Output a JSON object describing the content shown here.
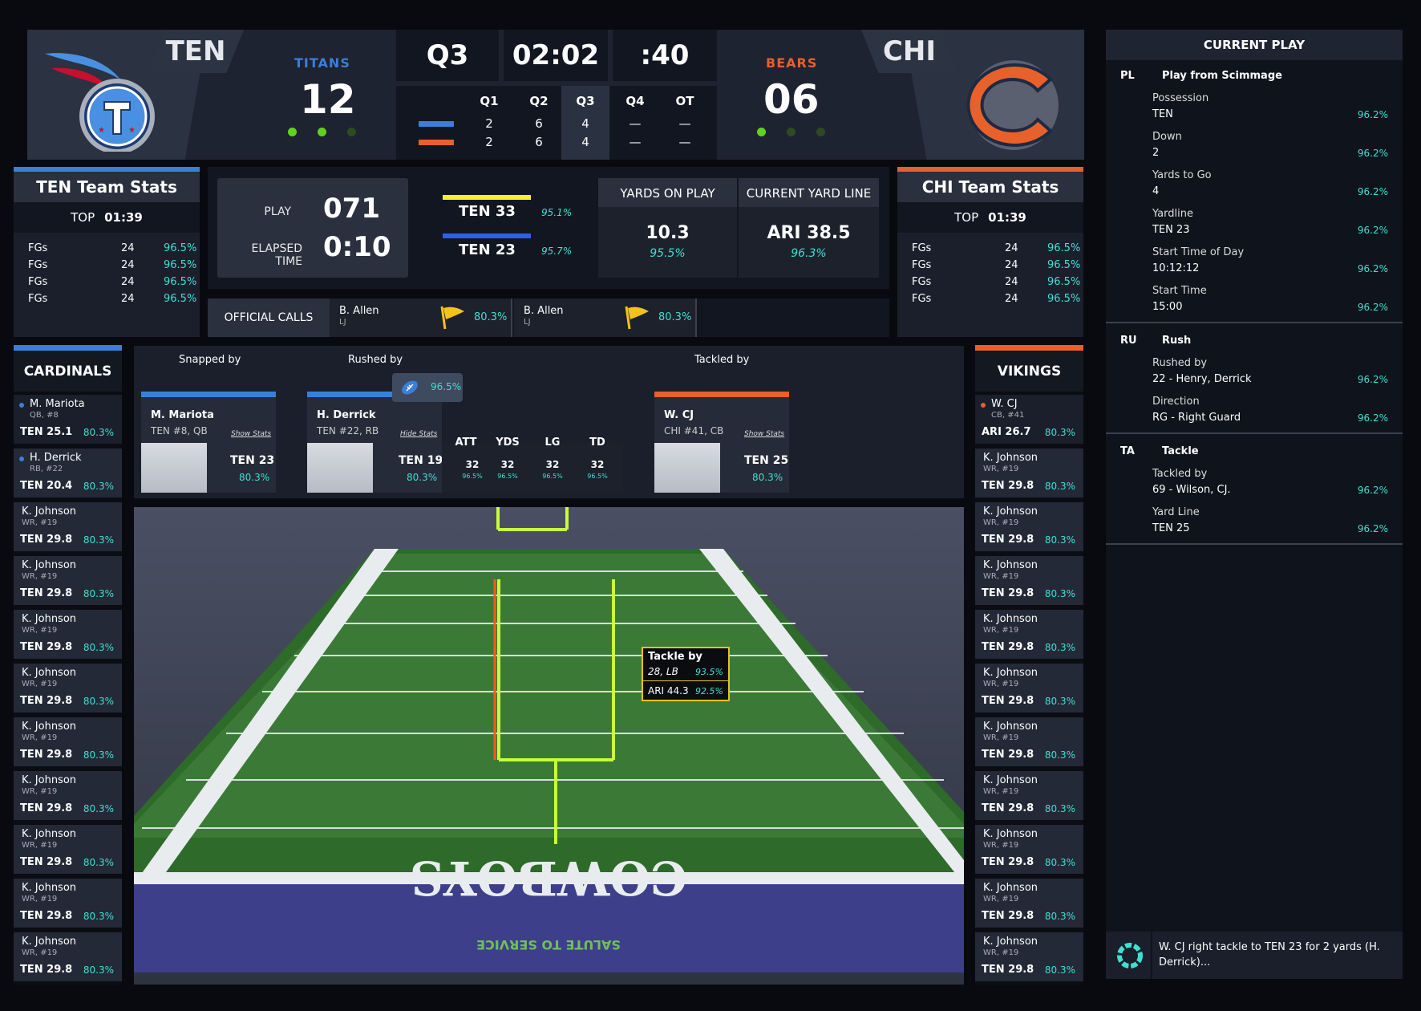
{
  "scoreboard": {
    "home": {
      "code": "TEN",
      "name": "TITANS",
      "score": "12",
      "color": "#3b7fd8"
    },
    "away": {
      "code": "CHI",
      "name": "BEARS",
      "score": "06",
      "color": "#e8602a"
    },
    "quarter": "Q3",
    "clock": "02:02",
    "play_clock": ":40",
    "periods": [
      "Q1",
      "Q2",
      "Q3",
      "Q4",
      "OT"
    ],
    "home_periods": [
      "2",
      "6",
      "4",
      "—",
      "—"
    ],
    "away_periods": [
      "2",
      "6",
      "4",
      "—",
      "—"
    ]
  },
  "ten_stats": {
    "title": "TEN Team Stats",
    "top_label": "TOP",
    "top_value": "01:39",
    "rows": [
      {
        "label": "FGs",
        "value": "24",
        "pct": "96.5%"
      },
      {
        "label": "FGs",
        "value": "24",
        "pct": "96.5%"
      },
      {
        "label": "FGs",
        "value": "24",
        "pct": "96.5%"
      },
      {
        "label": "FGs",
        "value": "24",
        "pct": "96.5%"
      }
    ]
  },
  "chi_stats": {
    "title": "CHI Team Stats",
    "top_label": "TOP",
    "top_value": "01:39",
    "rows": [
      {
        "label": "FGs",
        "value": "24",
        "pct": "96.5%"
      },
      {
        "label": "FGs",
        "value": "24",
        "pct": "96.5%"
      },
      {
        "label": "FGs",
        "value": "24",
        "pct": "96.5%"
      },
      {
        "label": "FGs",
        "value": "24",
        "pct": "96.5%"
      }
    ]
  },
  "play_info": {
    "play_label": "PLAY",
    "play_value": "071",
    "elapsed_label_1": "ELAPSED",
    "elapsed_label_2": "TIME",
    "elapsed_value": "0:10",
    "line1": {
      "label": "TEN 33",
      "pct": "95.1%",
      "color": "#f5f22a"
    },
    "line2": {
      "label": "TEN 23",
      "pct": "95.7%",
      "color": "#2f5fe8"
    },
    "yards_on_play_label": "YARDS ON PLAY",
    "yards_on_play_value": "10.3",
    "yards_on_play_pct": "95.5%",
    "yard_line_label": "CURRENT YARD LINE",
    "yard_line_value": "ARI 38.5",
    "yard_line_pct": "96.3%"
  },
  "official_calls": {
    "label": "OFFICIAL CALLS",
    "calls": [
      {
        "name": "B. Allen",
        "pos": "LJ",
        "pct": "80.3%"
      },
      {
        "name": "B. Allen",
        "pos": "LJ",
        "pct": "80.3%"
      }
    ]
  },
  "play_cards": {
    "snapped_label": "Snapped by",
    "rushed_label": "Rushed by",
    "tackled_label": "Tackled by",
    "ball_pct": "96.5%",
    "snapper": {
      "name": "M. Mariota",
      "sub": "TEN #8, QB",
      "link": "Show Stats",
      "yardline": "TEN 23",
      "pct": "80.3%"
    },
    "rusher": {
      "name": "H. Derrick",
      "sub": "TEN #22, RB",
      "link": "Hide Stats",
      "yardline": "TEN 19",
      "pct": "80.3%",
      "stats": [
        {
          "label": "ATT",
          "value": "32",
          "pct": "96.5%"
        },
        {
          "label": "YDS",
          "value": "32",
          "pct": "96.5%"
        },
        {
          "label": "LG",
          "value": "32",
          "pct": "96.5%"
        },
        {
          "label": "TD",
          "value": "32",
          "pct": "96.5%"
        }
      ]
    },
    "tackler": {
      "name": "W. CJ",
      "sub": "CHI #41, CB",
      "link": "Show Stats",
      "yardline": "TEN 25",
      "pct": "80.3%"
    }
  },
  "field": {
    "tackle_label": "Tackle by",
    "tackle_player": "28, LB",
    "tackle_pct": "93.5%",
    "tackle_yardline": "ARI 44.3",
    "tackle_yardline_pct": "92.5%",
    "end_zone_text": "COWBOYS",
    "banner_text": "SALUTE TO SERVICE"
  },
  "cardinals": {
    "title": "CARDINALS",
    "players": [
      {
        "name": "M. Mariota",
        "sub": "QB, #8",
        "yardline": "TEN 25.1",
        "pct": "80.3%"
      },
      {
        "name": "H. Derrick",
        "sub": "RB, #22",
        "yardline": "TEN 20.4",
        "pct": "80.3%"
      },
      {
        "name": "K. Johnson",
        "sub": "WR, #19",
        "yardline": "TEN 29.8",
        "pct": "80.3%"
      },
      {
        "name": "K. Johnson",
        "sub": "WR, #19",
        "yardline": "TEN 29.8",
        "pct": "80.3%"
      },
      {
        "name": "K. Johnson",
        "sub": "WR, #19",
        "yardline": "TEN 29.8",
        "pct": "80.3%"
      },
      {
        "name": "K. Johnson",
        "sub": "WR, #19",
        "yardline": "TEN 29.8",
        "pct": "80.3%"
      },
      {
        "name": "K. Johnson",
        "sub": "WR, #19",
        "yardline": "TEN 29.8",
        "pct": "80.3%"
      },
      {
        "name": "K. Johnson",
        "sub": "WR, #19",
        "yardline": "TEN 29.8",
        "pct": "80.3%"
      },
      {
        "name": "K. Johnson",
        "sub": "WR, #19",
        "yardline": "TEN 29.8",
        "pct": "80.3%"
      },
      {
        "name": "K. Johnson",
        "sub": "WR, #19",
        "yardline": "TEN 29.8",
        "pct": "80.3%"
      },
      {
        "name": "K. Johnson",
        "sub": "WR, #19",
        "yardline": "TEN 29.8",
        "pct": "80.3%"
      }
    ]
  },
  "vikings": {
    "title": "VIKINGS",
    "players": [
      {
        "name": "W. CJ",
        "sub": "CB, #41",
        "yardline": "ARI 26.7",
        "pct": "80.3%"
      },
      {
        "name": "K. Johnson",
        "sub": "WR, #19",
        "yardline": "TEN 29.8",
        "pct": "80.3%"
      },
      {
        "name": "K. Johnson",
        "sub": "WR, #19",
        "yardline": "TEN 29.8",
        "pct": "80.3%"
      },
      {
        "name": "K. Johnson",
        "sub": "WR, #19",
        "yardline": "TEN 29.8",
        "pct": "80.3%"
      },
      {
        "name": "K. Johnson",
        "sub": "WR, #19",
        "yardline": "TEN 29.8",
        "pct": "80.3%"
      },
      {
        "name": "K. Johnson",
        "sub": "WR, #19",
        "yardline": "TEN 29.8",
        "pct": "80.3%"
      },
      {
        "name": "K. Johnson",
        "sub": "WR, #19",
        "yardline": "TEN 29.8",
        "pct": "80.3%"
      },
      {
        "name": "K. Johnson",
        "sub": "WR, #19",
        "yardline": "TEN 29.8",
        "pct": "80.3%"
      },
      {
        "name": "K. Johnson",
        "sub": "WR, #19",
        "yardline": "TEN 29.8",
        "pct": "80.3%"
      },
      {
        "name": "K. Johnson",
        "sub": "WR, #19",
        "yardline": "TEN 29.8",
        "pct": "80.3%"
      },
      {
        "name": "K. Johnson",
        "sub": "WR, #19",
        "yardline": "TEN 29.8",
        "pct": "80.3%"
      }
    ]
  },
  "current_play": {
    "title": "CURRENT PLAY",
    "sections": [
      {
        "code": "PL",
        "title": "Play from Scimmage",
        "fields": [
          {
            "key": "Possession",
            "value": "TEN",
            "pct": "96.2%"
          },
          {
            "key": "Down",
            "value": "2",
            "pct": "96.2%"
          },
          {
            "key": "Yards to Go",
            "value": "4",
            "pct": "96.2%"
          },
          {
            "key": "Yardline",
            "value": "TEN 23",
            "pct": "96.2%"
          },
          {
            "key": "Start Time of Day",
            "value": "10:12:12",
            "pct": "96.2%"
          },
          {
            "key": "Start Time",
            "value": "15:00",
            "pct": "96.2%"
          }
        ]
      },
      {
        "code": "RU",
        "title": "Rush",
        "fields": [
          {
            "key": "Rushed by",
            "value": "22 - Henry, Derrick",
            "pct": "96.2%"
          },
          {
            "key": "Direction",
            "value": "RG - Right Guard",
            "pct": "96.2%"
          }
        ]
      },
      {
        "code": "TA",
        "title": "Tackle",
        "fields": [
          {
            "key": "Tackled by",
            "value": "69 - Wilson, CJ.",
            "pct": "96.2%"
          },
          {
            "key": "Yard Line",
            "value": "TEN 25",
            "pct": "96.2%"
          }
        ]
      }
    ],
    "summary": "W. CJ right tackle to TEN 23 for 2 yards (H. Derrick)..."
  }
}
